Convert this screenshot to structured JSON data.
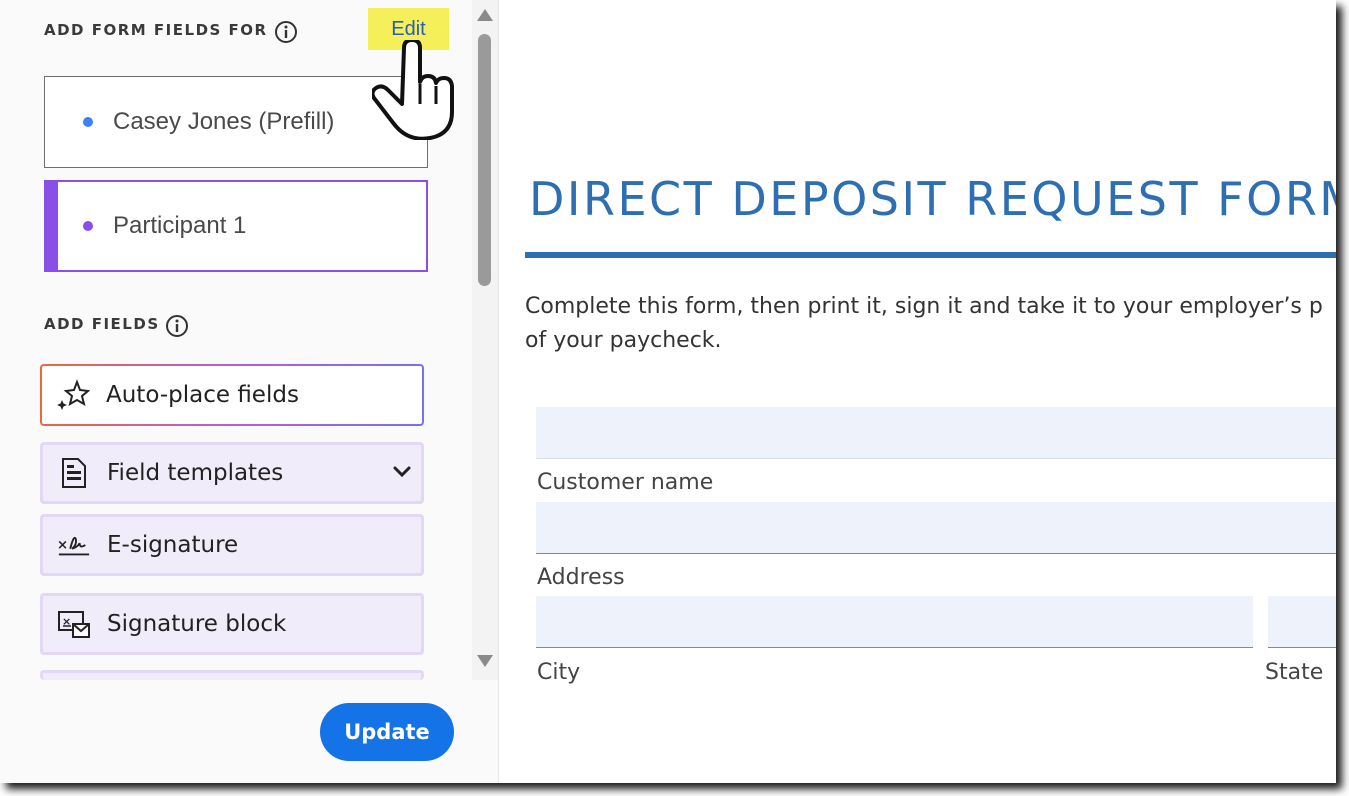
{
  "panel": {
    "add_form_fields_title": "ADD FORM FIELDS FOR",
    "edit_label": "Edit",
    "participants": [
      {
        "label": "Casey Jones (Prefill)",
        "color": "#3b82f6"
      },
      {
        "label": "Participant 1",
        "color": "#8a4fe6"
      }
    ],
    "add_fields_title": "ADD FIELDS",
    "fields": [
      {
        "label": "Auto-place fields",
        "icon": "sparkle-icon"
      },
      {
        "label": "Field templates",
        "icon": "document-icon"
      },
      {
        "label": "E-signature",
        "icon": "signature-icon"
      },
      {
        "label": "Signature block",
        "icon": "signature-block-icon"
      }
    ],
    "update_label": "Update"
  },
  "document": {
    "title": "DIRECT DEPOSIT REQUEST FORM",
    "description_line1": "Complete this form, then print it, sign it and take it to your employer’s p",
    "description_line2": "of your paycheck.",
    "labels": {
      "customer_name": "Customer name",
      "address": "Address",
      "city": "City",
      "state": "State"
    }
  },
  "colors": {
    "accent_blue": "#1473e6",
    "title_blue": "#2e6fb1",
    "purple": "#8a4fe6",
    "highlight": "#f5f05a"
  }
}
